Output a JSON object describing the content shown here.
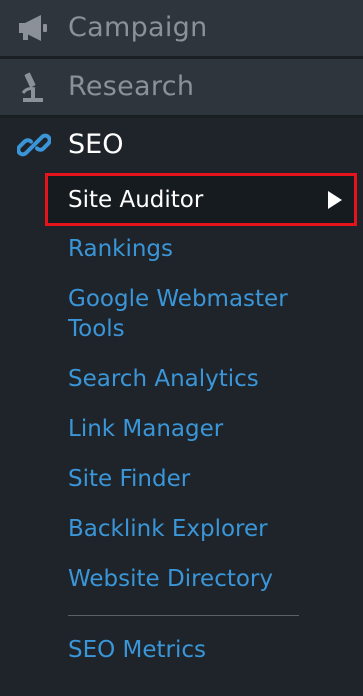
{
  "menu": {
    "campaign": {
      "label": "Campaign",
      "icon": "megaphone-icon"
    },
    "research": {
      "label": "Research",
      "icon": "microscope-icon"
    },
    "seo": {
      "label": "SEO",
      "icon": "link-icon",
      "active_item": "Site Auditor",
      "items": [
        "Rankings",
        "Google Webmaster",
        "Tools",
        "Search Analytics",
        "Link Manager",
        "Site Finder",
        "Backlink Explorer",
        "Website Directory"
      ],
      "extra_item": "SEO Metrics"
    }
  },
  "colors": {
    "background": "#1e2429",
    "top_item_bg": "#2e353c",
    "link": "#3a96d8",
    "highlight_border": "#e5141c",
    "muted_text": "#8b9196"
  }
}
